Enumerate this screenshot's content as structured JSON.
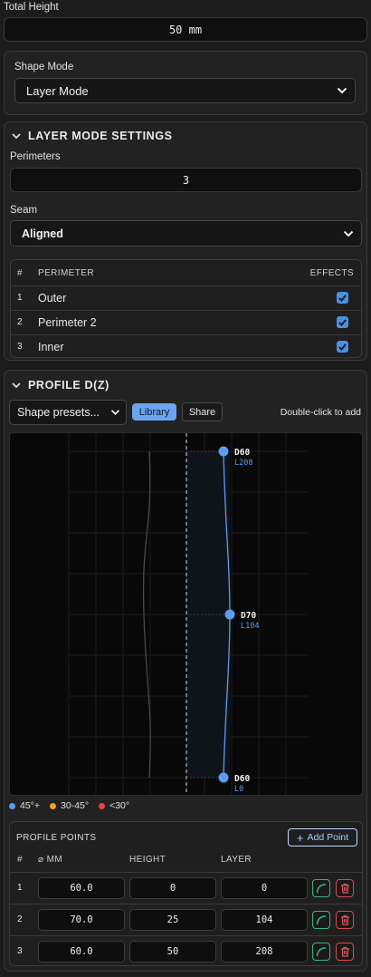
{
  "total_height": {
    "label": "Total Height",
    "value": "50 mm"
  },
  "shape_mode": {
    "label": "Shape Mode",
    "selected": "Layer Mode"
  },
  "layer_mode_settings": {
    "title": "LAYER MODE SETTINGS",
    "perimeters": {
      "label": "Perimeters",
      "value": "3"
    },
    "seam": {
      "label": "Seam",
      "selected": "Aligned"
    },
    "table": {
      "headers": {
        "num": "#",
        "perimeter": "PERIMETER",
        "effects": "EFFECTS"
      },
      "rows": [
        {
          "num": "1",
          "name": "Outer",
          "effects": true
        },
        {
          "num": "2",
          "name": "Perimeter 2",
          "effects": true
        },
        {
          "num": "3",
          "name": "Inner",
          "effects": true
        }
      ]
    }
  },
  "profile": {
    "title": "PROFILE D(Z)",
    "presets_selected": "Shape presets...",
    "library_label": "Library",
    "share_label": "Share",
    "hint": "Double-click to add",
    "graph_points": [
      {
        "d": "D60",
        "l": "L208"
      },
      {
        "d": "D70",
        "l": "L104"
      },
      {
        "d": "D60",
        "l": "L0"
      }
    ],
    "legend": [
      {
        "label": "45°+",
        "color": "#5b9cf0"
      },
      {
        "label": "30-45°",
        "color": "#f0a020"
      },
      {
        "label": "<30°",
        "color": "#e04848"
      }
    ],
    "points_title": "PROFILE POINTS",
    "add_point_label": "Add Point",
    "headers": {
      "num": "#",
      "diameter": "⌀ MM",
      "height": "HEIGHT",
      "layer": "LAYER"
    },
    "rows": [
      {
        "num": "1",
        "diameter": "60.0",
        "height": "0",
        "layer": "0"
      },
      {
        "num": "2",
        "diameter": "70.0",
        "height": "25",
        "layer": "104"
      },
      {
        "num": "3",
        "diameter": "60.0",
        "height": "50",
        "layer": "208"
      }
    ]
  }
}
